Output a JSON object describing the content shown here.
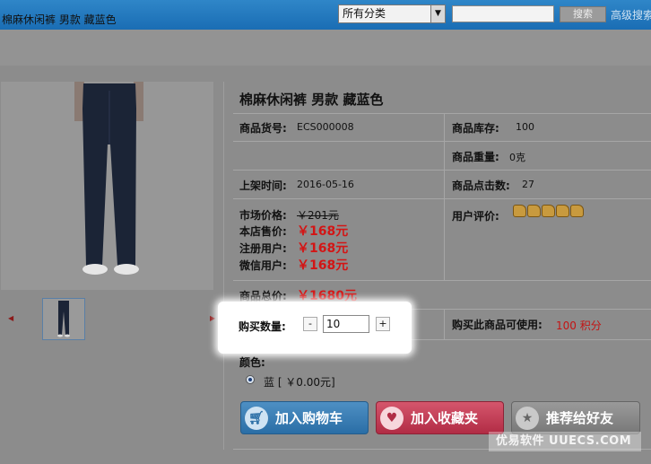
{
  "header": {
    "category_select": "所有分类",
    "search_button": "搜索",
    "advanced_search": "高级搜索"
  },
  "breadcrumb": "棉麻休闲裤 男款 藏蓝色",
  "product": {
    "title": "棉麻休闲裤 男款 藏蓝色",
    "sku_label": "商品货号:",
    "sku": "ECS000008",
    "stock_label": "商品库存:",
    "stock": "100",
    "weight_label": "商品重量:",
    "weight": "0克",
    "date_label": "上架时间:",
    "date": "2016-05-16",
    "clicks_label": "商品点击数:",
    "clicks": "27",
    "market_label": "市场价格:",
    "market_price": "￥201元",
    "shop_label": "本店售价:",
    "shop_price": "￥168元",
    "member_label": "注册用户:",
    "member_price": "￥168元",
    "wechat_label": "微信用户:",
    "wechat_price": "￥168元",
    "rating_label": "用户评价:",
    "rating": 5,
    "total_label": "商品总价:",
    "total_price": "￥1680元",
    "qty_label": "购买数量:",
    "qty_minus": "-",
    "qty_value": "10",
    "qty_plus": "+",
    "points_label": "购买此商品可使用:",
    "points": "100 积分",
    "color_label": "颜色:",
    "color_option": "蓝 [ ￥0.00元]"
  },
  "actions": {
    "cart": "加入购物车",
    "favorite": "加入收藏夹",
    "recommend": "推荐给好友"
  },
  "watermark": "优易软件 UUECS.COM"
}
